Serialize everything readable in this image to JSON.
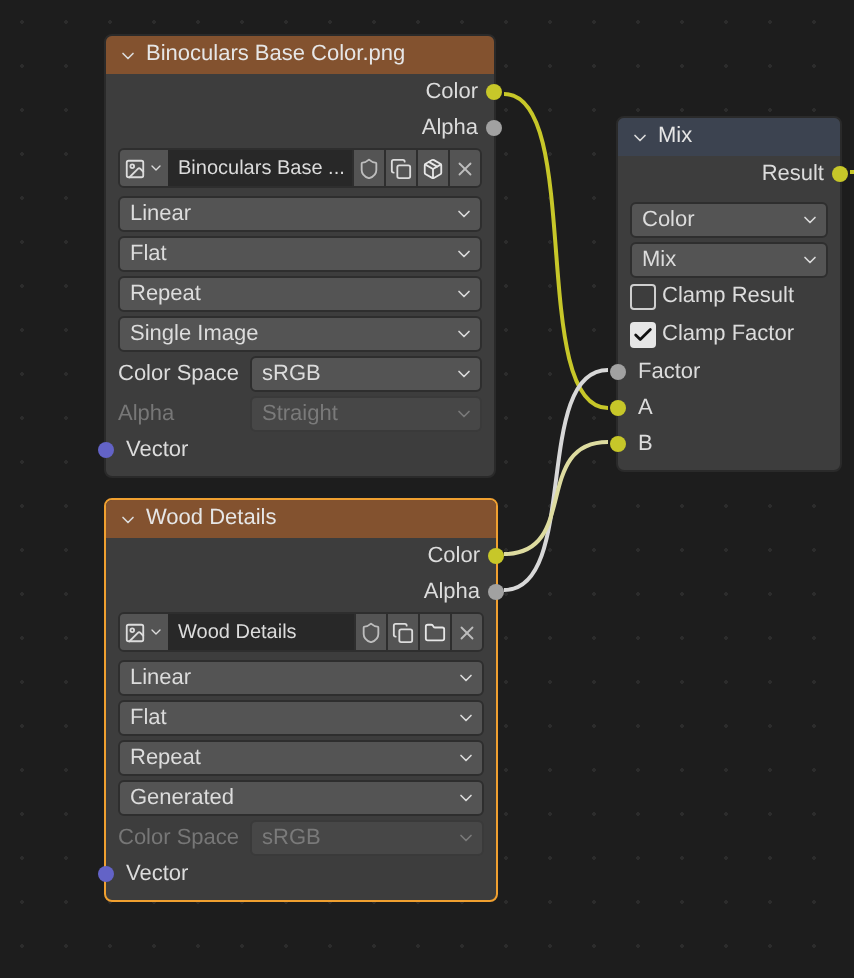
{
  "nodes": [
    {
      "kind": "texture",
      "title": "Binoculars Base Color.png",
      "selected": false,
      "rows": [
        {
          "kind": "output",
          "label": "Color",
          "color": "#c7c729"
        },
        {
          "kind": "output",
          "label": "Alpha",
          "color": "#a1a1a1"
        },
        {
          "kind": "image",
          "name": "Binoculars Base ...",
          "packed": true
        },
        {
          "kind": "dropdown",
          "value": "Linear"
        },
        {
          "kind": "dropdown",
          "value": "Flat"
        },
        {
          "kind": "dropdown",
          "value": "Repeat"
        },
        {
          "kind": "dropdown",
          "value": "Single Image"
        },
        {
          "kind": "field",
          "label": "Color Space",
          "value": "sRGB",
          "disabled": false
        },
        {
          "kind": "field",
          "label": "Alpha",
          "value": "Straight",
          "disabled": true
        },
        {
          "kind": "input",
          "label": "Vector",
          "color": "#6363c7"
        }
      ]
    },
    {
      "kind": "texture",
      "title": "Wood Details",
      "selected": true,
      "rows": [
        {
          "kind": "output",
          "label": "Color",
          "color": "#c7c729"
        },
        {
          "kind": "output",
          "label": "Alpha",
          "color": "#a1a1a1"
        },
        {
          "kind": "image",
          "name": "Wood Details",
          "packed": false
        },
        {
          "kind": "dropdown",
          "value": "Linear"
        },
        {
          "kind": "dropdown",
          "value": "Flat"
        },
        {
          "kind": "dropdown",
          "value": "Repeat"
        },
        {
          "kind": "dropdown",
          "value": "Generated"
        },
        {
          "kind": "field",
          "label": "Color Space",
          "value": "sRGB",
          "disabled": true
        },
        {
          "kind": "input",
          "label": "Vector",
          "color": "#6363c7"
        }
      ]
    },
    {
      "kind": "converter",
      "title": "Mix",
      "selected": false,
      "rows": [
        {
          "kind": "output",
          "label": "Result",
          "color": "#c7c729"
        },
        {
          "kind": "dropdown",
          "value": "Color"
        },
        {
          "kind": "dropdown",
          "value": "Mix"
        },
        {
          "kind": "checkbox",
          "label": "Clamp Result",
          "checked": false
        },
        {
          "kind": "checkbox",
          "label": "Clamp Factor",
          "checked": true
        },
        {
          "kind": "input",
          "label": "Factor",
          "color": "#a1a1a1"
        },
        {
          "kind": "input",
          "label": "A",
          "color": "#c7c729"
        },
        {
          "kind": "input",
          "label": "B",
          "color": "#c7c729"
        }
      ]
    }
  ]
}
